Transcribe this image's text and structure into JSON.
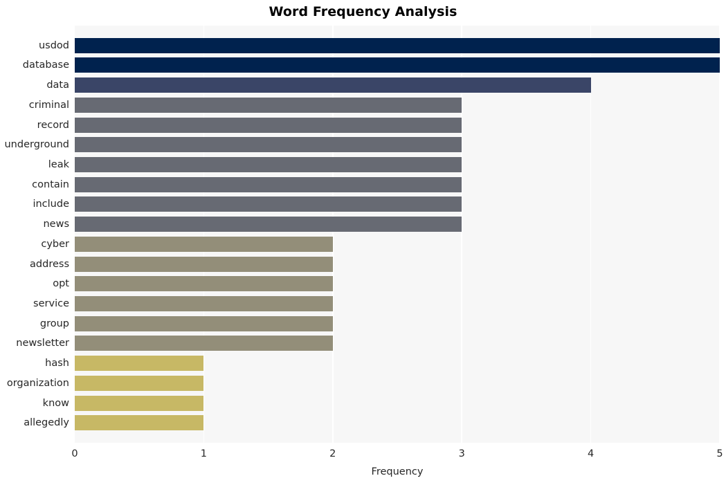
{
  "chart_data": {
    "type": "bar",
    "orientation": "horizontal",
    "title": "Word Frequency Analysis",
    "xlabel": "Frequency",
    "ylabel": "",
    "xlim": [
      0,
      5
    ],
    "xticks": [
      0,
      1,
      2,
      3,
      4,
      5
    ],
    "xtick_labels": [
      "0",
      "1",
      "2",
      "3",
      "4",
      "5"
    ],
    "grid": true,
    "grid_axis": "x",
    "legend": null,
    "categories": [
      "usdod",
      "database",
      "data",
      "criminal",
      "record",
      "underground",
      "leak",
      "contain",
      "include",
      "news",
      "cyber",
      "address",
      "opt",
      "service",
      "group",
      "newsletter",
      "hash",
      "organization",
      "know",
      "allegedly"
    ],
    "values": [
      5,
      5,
      4,
      3,
      3,
      3,
      3,
      3,
      3,
      3,
      2,
      2,
      2,
      2,
      2,
      2,
      1,
      1,
      1,
      1
    ],
    "bar_colors": [
      "#00224e",
      "#00224e",
      "#3a4567",
      "#676a73",
      "#676a73",
      "#676a73",
      "#676a73",
      "#676a73",
      "#676a73",
      "#676a73",
      "#938e79",
      "#938e79",
      "#938e79",
      "#938e79",
      "#938e79",
      "#938e79",
      "#c7b865",
      "#c7b865",
      "#c7b865",
      "#c7b865"
    ],
    "colors": {
      "plot_background": "#f7f7f7",
      "figure_background": "#ffffff",
      "gridline": "#ffffff",
      "text": "#262626",
      "title": "#000000"
    }
  }
}
